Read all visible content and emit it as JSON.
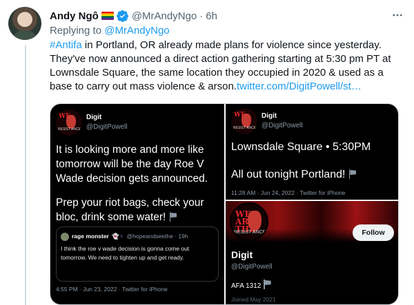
{
  "tweet": {
    "author_name": "Andy Ngô",
    "author_handle": "@MrAndyNgo",
    "separator": "·",
    "time": "6h",
    "reply_prefix": "Replying to",
    "reply_to": "@MrAndyNgo",
    "hashtag": "#Antifa",
    "text_body": " in Portland, OR already made plans for violence since yesterday. They've now announced a direct action gathering starting at 5:30 pm PT at Lownsdale Square, the same location they occupied in 2020 & used as a base to carry out mass violence & arson.",
    "link": "twitter.com/DigitPowell/st…",
    "more_icon": "more-horizontal-icon",
    "verified_icon": "verified-badge-icon",
    "flag_colors": [
      "#e40303",
      "#ff8c00",
      "#ffed00",
      "#008026",
      "#24408e",
      "#732982"
    ]
  },
  "media": {
    "left": {
      "logo_text": "WE ARE THE RESISTANCE",
      "logo_we": "WE",
      "logo_sub": "RESIST ANCE",
      "name": "Digit",
      "handle": "@DigitPowell",
      "text_p1": "It is looking more and more like tomorrow will be the day Roe V Wade decision gets announced.",
      "text_p2": "Prep your riot bags, check your bloc, drink some water!",
      "quote": {
        "name": "rage monster",
        "handle": "@hopeandseethe",
        "time": "19h",
        "separator": "·",
        "text": "I think the roe v wade decision is gonna come out tomorrow. We need to tighten up and get ready."
      },
      "footer": "4:55 PM · Jun 23, 2022 · Twitter for iPhone"
    },
    "top_right": {
      "logo_we": "WE",
      "logo_sub": "RESIST ANCE",
      "name": "Digit",
      "handle": "@DigitPowell",
      "line1": "Lownsdale Square • 5:30PM",
      "line2": "All out tonight Portland!",
      "footer": "11:28 AM · Jun 24, 2022 · Twitter for iPhone"
    },
    "bottom_right": {
      "logo_we": "WE ARE THE",
      "logo_sub": "RESIST ANCE",
      "follow_label": "Follow",
      "name": "Digit",
      "handle": "@DigitPowell",
      "bio": "AFA 1312",
      "faded": "Joined May 2021"
    }
  }
}
